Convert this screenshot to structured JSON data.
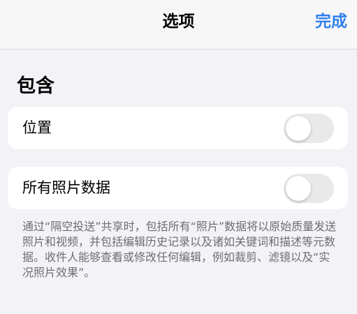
{
  "navbar": {
    "title": "选项",
    "done_label": "完成",
    "accent_color": "#2f80ed"
  },
  "section": {
    "header": "包含"
  },
  "settings": [
    {
      "label": "位置",
      "enabled": false
    },
    {
      "label": "所有照片数据",
      "enabled": false
    }
  ],
  "footnote": "通过“隔空投送”共享时，包括所有“照片”数据将以原始质量发送照片和视频，并包括编辑历史记录以及诸如关键词和描述等元数据。收件人能够查看或修改任何编辑，例如裁剪、滤镜以及“实况照片效果”。"
}
